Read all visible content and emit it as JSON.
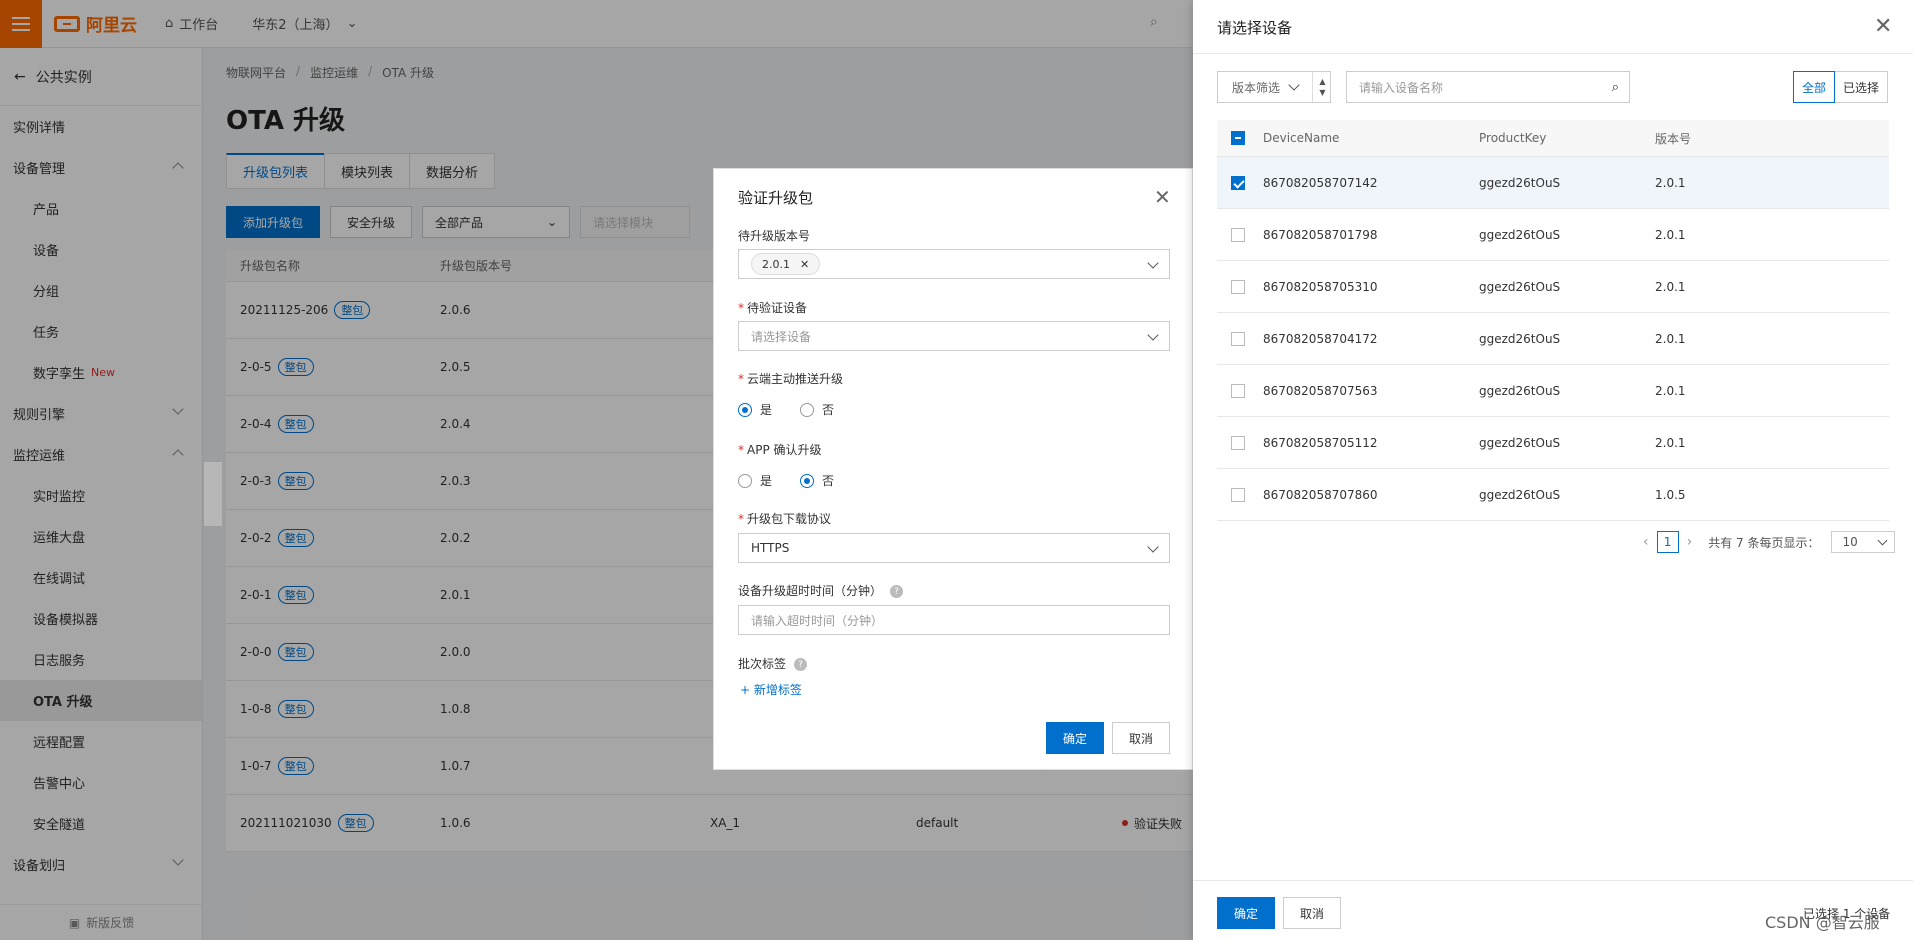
{
  "topbar": {
    "logo": "阿里云",
    "workbench": "工作台",
    "region": "华东2（上海）"
  },
  "sidebar": {
    "back": "公共实例",
    "items": [
      {
        "label": "实例详情",
        "level": "top"
      },
      {
        "label": "设备管理",
        "level": "top",
        "chev": "up"
      },
      {
        "label": "产品",
        "level": "sub"
      },
      {
        "label": "设备",
        "level": "sub"
      },
      {
        "label": "分组",
        "level": "sub"
      },
      {
        "label": "任务",
        "level": "sub"
      },
      {
        "label": "数字孪生",
        "level": "sub",
        "tag": "New"
      },
      {
        "label": "规则引擎",
        "level": "top",
        "chev": "down"
      },
      {
        "label": "监控运维",
        "level": "top",
        "chev": "up"
      },
      {
        "label": "实时监控",
        "level": "sub"
      },
      {
        "label": "运维大盘",
        "level": "sub"
      },
      {
        "label": "在线调试",
        "level": "sub"
      },
      {
        "label": "设备模拟器",
        "level": "sub"
      },
      {
        "label": "日志服务",
        "level": "sub"
      },
      {
        "label": "OTA 升级",
        "level": "sub",
        "active": true
      },
      {
        "label": "远程配置",
        "level": "sub"
      },
      {
        "label": "告警中心",
        "level": "sub"
      },
      {
        "label": "安全隧道",
        "level": "sub"
      },
      {
        "label": "设备划归",
        "level": "top",
        "chev": "down"
      }
    ],
    "feedback": "新版反馈"
  },
  "main": {
    "breadcrumb": [
      "物联网平台",
      "监控运维",
      "OTA 升级"
    ],
    "title": "OTA 升级",
    "tabs": [
      "升级包列表",
      "模块列表",
      "数据分析"
    ],
    "toolbar": {
      "add": "添加升级包",
      "secure": "安全升级",
      "product": "全部产品",
      "module": "请选择模块"
    },
    "table": {
      "headers": [
        "升级包名称",
        "升级包版本号"
      ],
      "badge": "整包",
      "rows": [
        {
          "name": "20211125-206",
          "version": "2.0.6"
        },
        {
          "name": "2-0-5",
          "version": "2.0.5"
        },
        {
          "name": "2-0-4",
          "version": "2.0.4"
        },
        {
          "name": "2-0-3",
          "version": "2.0.3"
        },
        {
          "name": "2-0-2",
          "version": "2.0.2"
        },
        {
          "name": "2-0-1",
          "version": "2.0.1"
        },
        {
          "name": "2-0-0",
          "version": "2.0.0"
        },
        {
          "name": "1-0-8",
          "version": "1.0.8"
        },
        {
          "name": "1-0-7",
          "version": "1.0.7"
        },
        {
          "name": "202111021030",
          "version": "1.0.6",
          "module": "XA_1",
          "product": "default",
          "status": "验证失败"
        }
      ]
    }
  },
  "dialog": {
    "title": "验证升级包",
    "version_label": "待升级版本号",
    "version_chip": "2.0.1",
    "device_label": "待验证设备",
    "device_placeholder": "请选择设备",
    "push_label": "云端主动推送升级",
    "yes": "是",
    "no": "否",
    "app_label": "APP 确认升级",
    "protocol_label": "升级包下载协议",
    "protocol_value": "HTTPS",
    "timeout_label": "设备升级超时时间（分钟）",
    "timeout_placeholder": "请输入超时时间（分钟）",
    "tag_label": "批次标签",
    "add_tag": "+ 新增标签",
    "ok": "确定",
    "cancel": "取消"
  },
  "drawer": {
    "title": "请选择设备",
    "version_filter": "版本筛选",
    "search_placeholder": "请输入设备名称",
    "tab_all": "全部",
    "tab_selected": "已选择",
    "headers": [
      "DeviceName",
      "ProductKey",
      "版本号"
    ],
    "rows": [
      {
        "device": "867082058707142",
        "key": "ggezd26tOuS",
        "version": "2.0.1",
        "checked": true
      },
      {
        "device": "867082058701798",
        "key": "ggezd26tOuS",
        "version": "2.0.1",
        "checked": false
      },
      {
        "device": "867082058705310",
        "key": "ggezd26tOuS",
        "version": "2.0.1",
        "checked": false
      },
      {
        "device": "867082058704172",
        "key": "ggezd26tOuS",
        "version": "2.0.1",
        "checked": false
      },
      {
        "device": "867082058707563",
        "key": "ggezd26tOuS",
        "version": "2.0.1",
        "checked": false
      },
      {
        "device": "867082058705112",
        "key": "ggezd26tOuS",
        "version": "2.0.1",
        "checked": false
      },
      {
        "device": "867082058707860",
        "key": "ggezd26tOuS",
        "version": "1.0.5",
        "checked": false
      }
    ],
    "pager": {
      "page": "1",
      "summary": "共有 7 条每页显示：",
      "size": "10"
    },
    "ok": "确定",
    "cancel": "取消",
    "selected_count": "已选择 1 个设备"
  },
  "watermark": "CSDN @智云服"
}
